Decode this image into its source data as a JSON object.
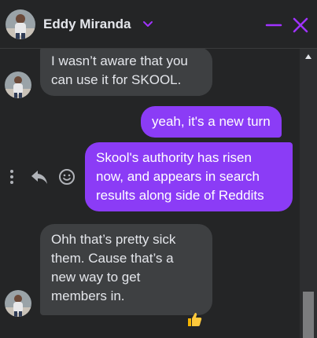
{
  "header": {
    "contact_name": "Eddy Miranda",
    "accent": "#a033ff"
  },
  "messages": [
    {
      "direction": "incoming",
      "text_lines": [
        "I wasn’t aware that you",
        "can use it for SKOOL."
      ]
    },
    {
      "direction": "outgoing",
      "text_lines": [
        "yeah, it's a new turn"
      ]
    },
    {
      "direction": "outgoing",
      "text_lines": [
        "Skool's authority has risen",
        "now, and appears in search",
        "results along side of Reddits"
      ]
    },
    {
      "direction": "incoming",
      "text_lines": [
        "Ohh that’s pretty sick",
        "them. Cause that’s a",
        "new way to get",
        "members in."
      ],
      "reaction": "thumbs-up"
    }
  ],
  "colors": {
    "background": "#242526",
    "incoming_bubble": "#3e4042",
    "outgoing_bubble": "#8b3cf6"
  }
}
